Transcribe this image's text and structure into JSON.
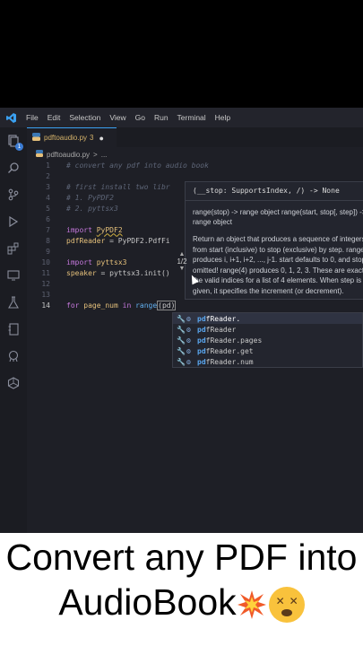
{
  "menu": {
    "items": [
      "File",
      "Edit",
      "Selection",
      "View",
      "Go",
      "Run",
      "Terminal",
      "Help"
    ]
  },
  "activity_bar": {
    "icons": [
      "explorer-icon",
      "search-icon",
      "source-control-icon",
      "run-debug-icon",
      "extensions-icon",
      "remote-explorer-icon",
      "testing-icon",
      "notebook-icon",
      "github-icon",
      "docker-icon"
    ],
    "badge": "1"
  },
  "tab": {
    "file_name": "pdftoaudio.py",
    "problem_count": "3",
    "dirty_marker": "●",
    "icon_text": "py"
  },
  "breadcrumb": {
    "file_name": "pdftoaudio.py",
    "separator": ">",
    "more": "..."
  },
  "editor": {
    "lines": [
      {
        "n": "1",
        "text": "# convert any pdf into audio book"
      },
      {
        "n": "2",
        "text": ""
      },
      {
        "n": "3",
        "text": "# first install two libr"
      },
      {
        "n": "4",
        "text": "# 1. PyPDF2"
      },
      {
        "n": "5",
        "text": "# 2. pyttsx3"
      },
      {
        "n": "6",
        "text": ""
      },
      {
        "n": "7",
        "kw": "import",
        "mod": "PyPDF2"
      },
      {
        "n": "8",
        "var": "pdfReader",
        "rest": " = PyPDF2.PdfFi"
      },
      {
        "n": "9",
        "text": ""
      },
      {
        "n": "10",
        "kw": "import",
        "mod": "pyttsx3"
      },
      {
        "n": "11",
        "var": "speaker",
        "rest": " = pyttsx3.init()"
      },
      {
        "n": "12",
        "text": ""
      },
      {
        "n": "13",
        "text": ""
      },
      {
        "n": "14",
        "kw": "for",
        "mid": " page_num ",
        "kw2": "in",
        "fn": " range",
        "arg": "(pd)"
      }
    ],
    "active_line": "14"
  },
  "hover": {
    "signature": "(__stop: SupportsIndex, /) -> None",
    "signature2": "range(stop) -> range object range(start, stop[, step]) -> range object",
    "description": "Return an object that produces a sequence of integers from start (inclusive) to stop (exclusive) by step. range(i, j) produces i, i+1, i+2, ..., j-1. start defaults to 0, and stop is omitted! range(4) produces 0, 1, 2, 3. These are exactly the valid indices for a list of 4 elements. When step is given, it specifies the increment (or decrement).",
    "overload": "1/2"
  },
  "suggestions": [
    {
      "prefix": "pd",
      "rest": "fReader.",
      "selected": true
    },
    {
      "prefix": "pd",
      "rest": "fReader",
      "selected": false
    },
    {
      "prefix": "pd",
      "rest": "fReader.pages",
      "selected": false
    },
    {
      "prefix": "pd",
      "rest": "fReader.get",
      "selected": false
    },
    {
      "prefix": "pd",
      "rest": "fReader.num",
      "selected": false
    }
  ],
  "caption": {
    "line1": "Convert any PDF into",
    "line2": "AudioBook",
    "boom": "💥",
    "face": "😵"
  }
}
